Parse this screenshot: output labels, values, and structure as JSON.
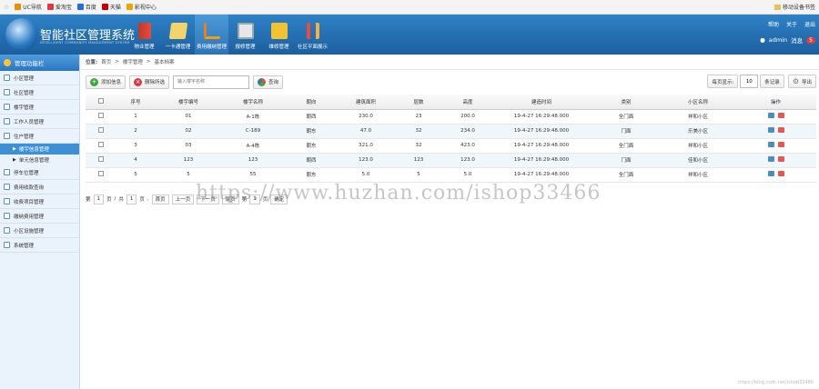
{
  "bookmarks": [
    "UC导航",
    "爱淘宝",
    "百度",
    "天猫",
    "影视中心"
  ],
  "bookmarks_right": "移动设备书签",
  "app": {
    "title": "智能社区管理系统",
    "subtitle": "INTELLIGENT COMMUNITY MANAGEMENT SYSTEM"
  },
  "nav": [
    "物业管理",
    "一卡通管理",
    "费用缴纳管理",
    "报修管理",
    "维修管理",
    "社区平面展示"
  ],
  "header_links": [
    "帮助",
    "关于",
    "退出"
  ],
  "user": {
    "name": "admin",
    "messages_label": "消息",
    "messages_count": "5"
  },
  "sidebar": {
    "title": "管理功能栏",
    "items_top": [
      "小区管理",
      "社区管理",
      "楼宇管理",
      "工作人员管理",
      "住户管理"
    ],
    "sub_items": [
      "楼宇信息管理",
      "单元信息管理"
    ],
    "items_bottom": [
      "停车位管理",
      "费用收款查询",
      "收费项目管理",
      "缴纳费用管理",
      "小区设施管理",
      "系统管理"
    ]
  },
  "breadcrumb": {
    "label": "位置:",
    "items": [
      "首页",
      "楼宇管理",
      "基本档案"
    ]
  },
  "toolbar": {
    "add": "添加信息",
    "delete": "删除所选",
    "search_placeholder": "输入楼宇名称",
    "query": "查询",
    "per_page_label": "每页显示:",
    "per_page_value": "10",
    "per_page_unit": "条记录",
    "export": "导出"
  },
  "table": {
    "headers": [
      "序号",
      "楼宇编号",
      "楼宇名称",
      "朝向",
      "建筑面积",
      "层数",
      "高度",
      "建造时间",
      "类别",
      "小区名称",
      "操作"
    ],
    "rows": [
      [
        "1",
        "01",
        "A-1栋",
        "朝西",
        "230.0",
        "23",
        "200.0",
        "19-4-27 16:29:48.000",
        "全门面",
        "祥和小区"
      ],
      [
        "2",
        "02",
        "C-189",
        "朝东",
        "47.0",
        "32",
        "234.0",
        "19-4-27 16:29:48.000",
        "门面",
        "乐美小区"
      ],
      [
        "3",
        "03",
        "A-4栋",
        "朝东",
        "321.0",
        "32",
        "423.0",
        "19-4-27 16:29:48.000",
        "全门面",
        "祥和小区"
      ],
      [
        "4",
        "123",
        "123",
        "朝西",
        "123.0",
        "123",
        "123.0",
        "19-4-27 16:29:48.000",
        "门面",
        "佳和小区"
      ],
      [
        "5",
        "5",
        "55",
        "朝东",
        "5.0",
        "5",
        "5.0",
        "19-4-27 16:29:48.000",
        "全门面",
        "祥和小区"
      ]
    ]
  },
  "pager": [
    "第",
    "1",
    "页",
    "/",
    "共",
    "1",
    "页",
    ",",
    "首页",
    "上一页",
    "下一页",
    "尾页",
    "第",
    "1",
    "页",
    "确定"
  ],
  "watermark": "https://www.huzhan.com/ishop33466",
  "credit": "https://blog.csdn.net/ishop33466",
  "colors": {
    "header": "#2673b7",
    "accent": "#3d8fd6",
    "add": "#3aa83a",
    "delete": "#d9363e",
    "badge": "#e23b3b"
  }
}
